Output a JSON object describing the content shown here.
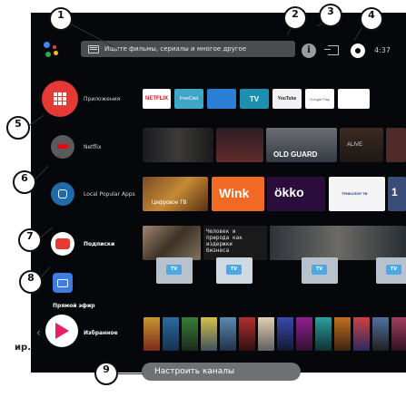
{
  "topbar": {
    "search_placeholder": "Ищите фильмы, сериалы и многое другое",
    "time": "4:37"
  },
  "rows": [
    {
      "label": "Приложения",
      "icon": "apps-grid-icon",
      "color": "#e53935"
    },
    {
      "label": "Netflix",
      "icon": "netflix-icon"
    },
    {
      "label": "Local Popular Apps",
      "icon": "local-apps-icon"
    },
    {
      "label": "Подписки",
      "icon": "youtube-icon",
      "color": "#e53935"
    },
    {
      "label": "Прямой эфир",
      "icon": "live-tv-icon",
      "color": "#3d7be6"
    },
    {
      "label": "Избранное",
      "icon": "google-play-movies-icon",
      "color": "#e91e63"
    }
  ],
  "apps_row": {
    "tiles": [
      "NETFLIX",
      "FreeCast",
      "",
      "TV",
      "YouTube",
      "Google Play",
      ""
    ]
  },
  "netflix_row": {
    "tiles": [
      "",
      "",
      "OLD GUARD",
      "ALIVE",
      ""
    ]
  },
  "local_row": {
    "tiles": [
      "Цифровое ТВ",
      "Wink",
      "ökko",
      "ТРИКОЛОР ТВ",
      "1"
    ]
  },
  "subs_row": {
    "tiles": [
      "Человек и природа как издержки бизнеса",
      "",
      ""
    ]
  },
  "live_row": {
    "tiles": [
      "TV",
      "TV",
      "TV",
      "TV"
    ]
  },
  "customize_button": "Настроить каналы",
  "external_text": "ир.",
  "callouts": [
    "1",
    "2",
    "3",
    "4",
    "5",
    "6",
    "7",
    "8",
    "9"
  ],
  "colors": {
    "background": "#06070a",
    "apps_red": "#e53935",
    "live_blue": "#3d7be6",
    "play_pink": "#e91e63",
    "search_bg": "#4a4c50"
  }
}
